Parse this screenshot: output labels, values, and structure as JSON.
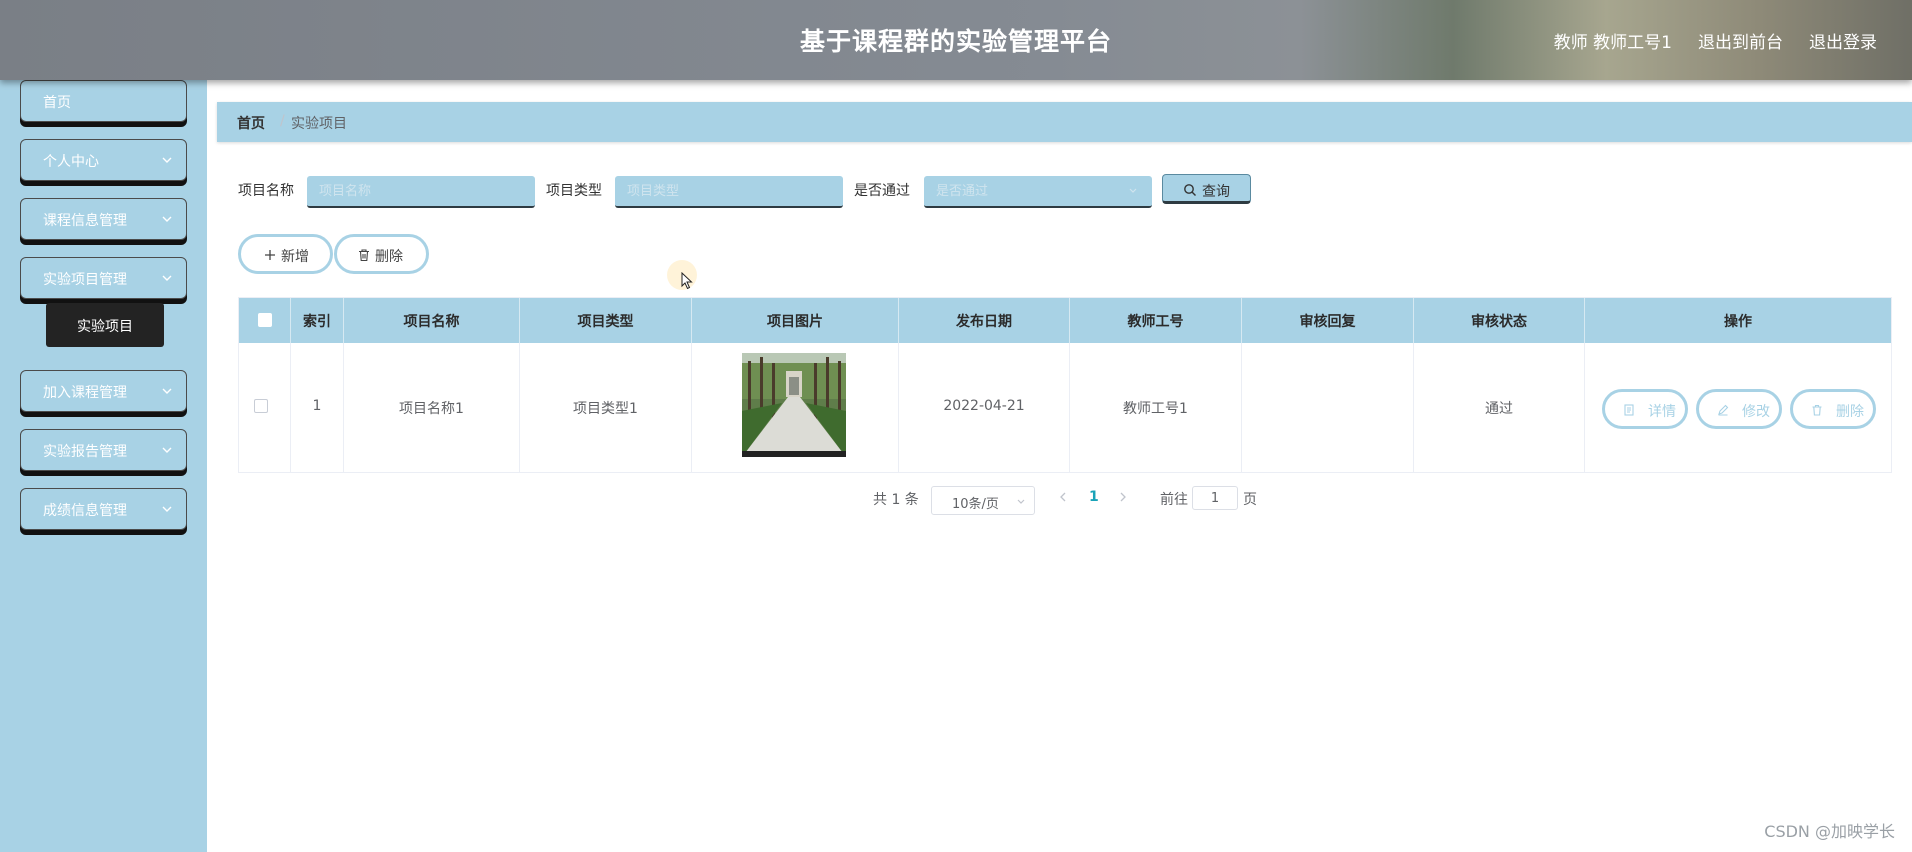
{
  "header": {
    "title": "基于课程群的实验管理平台",
    "user": "教师 教师工号1",
    "to_frontend": "退出到前台",
    "logout": "退出登录"
  },
  "sidebar": {
    "items": [
      {
        "label": "首页"
      },
      {
        "label": "个人中心"
      },
      {
        "label": "课程信息管理"
      },
      {
        "label": "实验项目管理"
      },
      {
        "label": "加入课程管理"
      },
      {
        "label": "实验报告管理"
      },
      {
        "label": "成绩信息管理"
      }
    ],
    "submenu_active": "实验项目"
  },
  "breadcrumb": {
    "home": "首页",
    "separator": "/",
    "current": "实验项目"
  },
  "search": {
    "name_label": "项目名称",
    "name_placeholder": "项目名称",
    "type_label": "项目类型",
    "type_placeholder": "项目类型",
    "pass_label": "是否通过",
    "pass_placeholder": "是否通过",
    "query_button": "查询"
  },
  "actions": {
    "add": "新增",
    "delete": "删除"
  },
  "table": {
    "columns": [
      "索引",
      "项目名称",
      "项目类型",
      "项目图片",
      "发布日期",
      "教师工号",
      "审核回复",
      "审核状态",
      "操作"
    ],
    "rows": [
      {
        "index": "1",
        "name": "项目名称1",
        "type": "项目类型1",
        "image": "campus-walkway-photo",
        "date": "2022-04-21",
        "teacher_no": "教师工号1",
        "review_reply": "",
        "review_status": "通过",
        "ops": {
          "detail": "详情",
          "edit": "修改",
          "delete": "删除"
        }
      }
    ]
  },
  "pagination": {
    "total": "共 1 条",
    "page_size": "10条/页",
    "current_page": "1",
    "goto_label": "前往",
    "goto_value": "1",
    "page_unit": "页"
  },
  "watermark": "CSDN @加映学长",
  "colors": {
    "accent": "#a8d2e5",
    "header": "#858b93",
    "active_submenu": "#232323",
    "page_active": "#1aa3b8"
  }
}
